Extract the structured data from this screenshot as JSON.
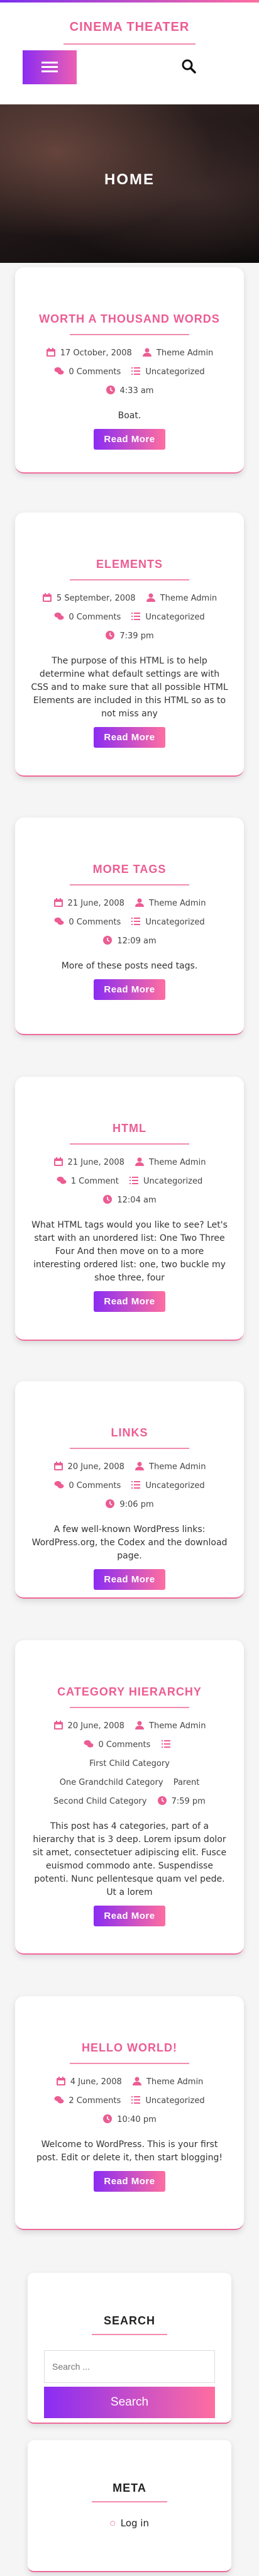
{
  "site": {
    "title": "CINEMA THEATER"
  },
  "hero": {
    "title": "HOME"
  },
  "colors": {
    "accent": "#ec5c93",
    "gradient_start": "#8a2cf3",
    "gradient_end": "#ff6ea0"
  },
  "posts": [
    {
      "title": "WORTH A THOUSAND WORDS",
      "date": "17 October, 2008",
      "author": "Theme Admin",
      "comments": "0 Comments",
      "category": "Uncategorized",
      "time": "4:33 am",
      "excerpt": "Boat.",
      "read_more": "Read More"
    },
    {
      "title": "ELEMENTS",
      "date": "5 September, 2008",
      "author": "Theme Admin",
      "comments": "0 Comments",
      "category": "Uncategorized",
      "time": "7:39 pm",
      "excerpt": "The purpose of this HTML is to help determine what default settings are with CSS and to make sure that all possible HTML Elements are included in this HTML so as to not miss any",
      "read_more": "Read More"
    },
    {
      "title": "MORE TAGS",
      "date": "21 June, 2008",
      "author": "Theme Admin",
      "comments": "0 Comments",
      "category": "Uncategorized",
      "time": "12:09 am",
      "excerpt": "More of these posts need tags.",
      "read_more": "Read More"
    },
    {
      "title": "HTML",
      "date": "21 June, 2008",
      "author": "Theme Admin",
      "comments": "1 Comment",
      "category": "Uncategorized",
      "time": "12:04 am",
      "excerpt": "What HTML tags would you like to see? Let's start with an unordered list: One Two Three Four And then move on to a more interesting ordered list: one, two buckle my shoe three, four",
      "read_more": "Read More"
    },
    {
      "title": "LINKS",
      "date": "20 June, 2008",
      "author": "Theme Admin",
      "comments": "0 Comments",
      "category": "Uncategorized",
      "time": "9:06 pm",
      "excerpt": "A few well-known WordPress links: WordPress.org, the Codex and the download page.",
      "read_more": "Read More"
    },
    {
      "title": "CATEGORY HIERARCHY",
      "date": "20 June, 2008",
      "author": "Theme Admin",
      "comments": "0 Comments",
      "category_list": [
        "First Child Category",
        "One Grandchild Category",
        "Parent",
        "Second Child Category"
      ],
      "time": "7:59 pm",
      "excerpt": "This post has 4 categories, part of a hierarchy that is 3 deep. Lorem ipsum dolor sit amet, consectetuer adipiscing elit. Fusce euismod commodo ante. Suspendisse potenti. Nunc pellentesque quam vel pede. Ut a lorem",
      "read_more": "Read More"
    },
    {
      "title": "HELLO WORLD!",
      "date": "4 June, 2008",
      "author": "Theme Admin",
      "comments": "2 Comments",
      "category": "Uncategorized",
      "time": "10:40 pm",
      "excerpt": "Welcome to WordPress. This is your first post. Edit or delete it, then start blogging!",
      "read_more": "Read More"
    }
  ],
  "widgets": {
    "search": {
      "title": "SEARCH",
      "placeholder": "Search ...",
      "button": "Search"
    },
    "meta": {
      "title": "META",
      "login": "Log in"
    }
  }
}
